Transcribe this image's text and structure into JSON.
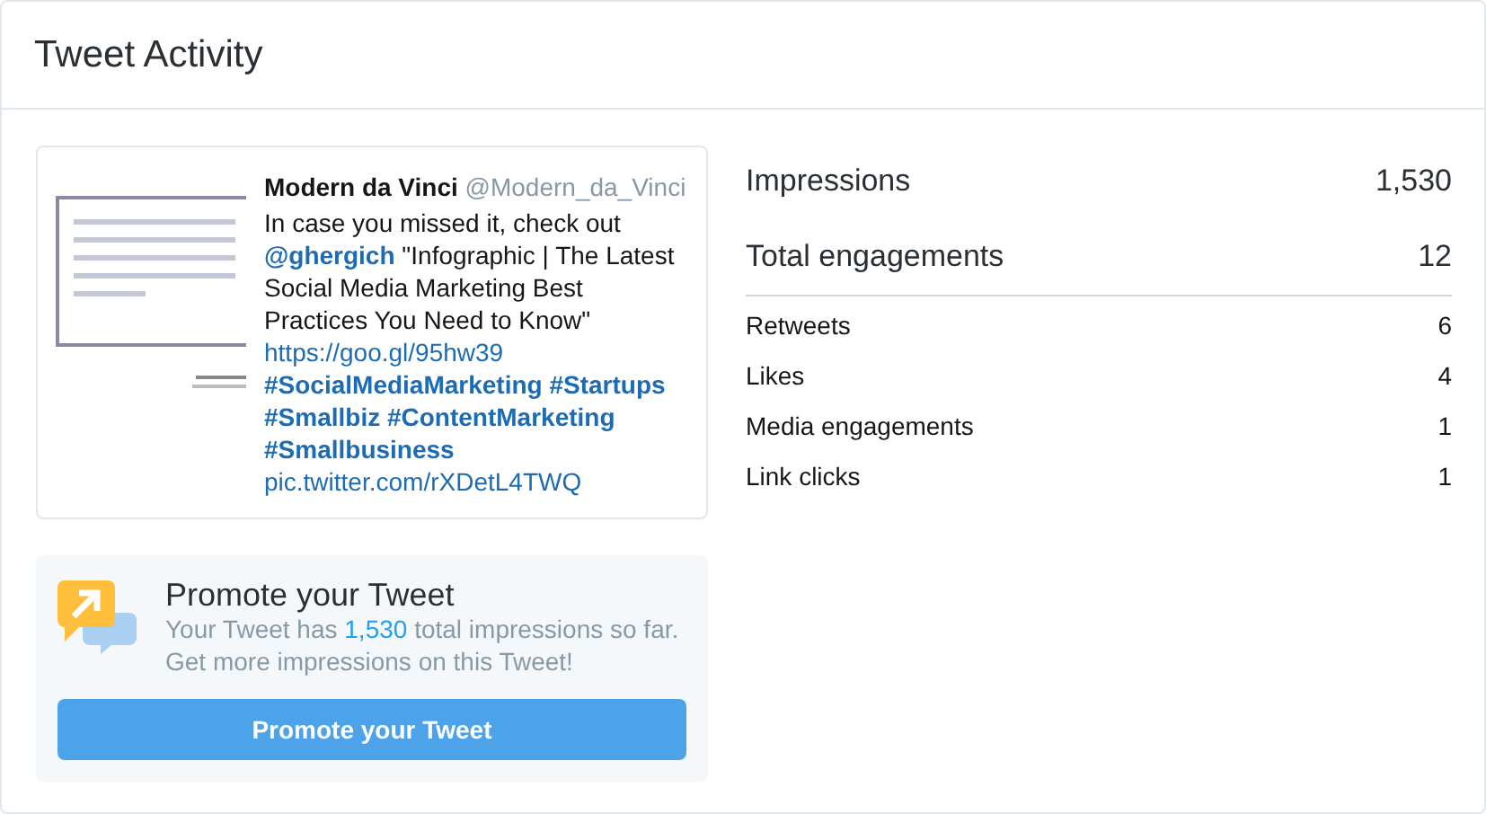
{
  "window": {
    "title": "Tweet Activity"
  },
  "tweet": {
    "author": "Modern da Vinci",
    "handle": "@Modern_da_Vinci",
    "segments": [
      {
        "kind": "text",
        "text": "In case you missed it, check out"
      },
      {
        "kind": "mention",
        "text": "@ghergich"
      },
      {
        "kind": "text",
        "text": "\"Infographic | The Latest Social Media Marketing Best Practices You Need to Know\""
      },
      {
        "kind": "link",
        "text": "https://goo.gl/95hw39"
      },
      {
        "kind": "hashtag",
        "text": "#SocialMediaMarketing"
      },
      {
        "kind": "hashtag",
        "text": "#Startups"
      },
      {
        "kind": "hashtag",
        "text": "#Smallbiz"
      },
      {
        "kind": "hashtag",
        "text": "#ContentMarketing"
      },
      {
        "kind": "hashtag",
        "text": "#Smallbusiness"
      },
      {
        "kind": "link",
        "text": "pic.twitter.com/rXDetL4TWQ"
      }
    ]
  },
  "promote": {
    "title": "Promote your Tweet",
    "message": "Your Tweet has **1,530** total impressions so far.",
    "message_2": "Get more impressions on this Tweet!",
    "button": "Promote your Tweet"
  },
  "metrics": [
    {
      "kind": "major",
      "label": "Impressions",
      "value": "1,530"
    },
    {
      "kind": "major",
      "label": "Total engagements",
      "value": "12"
    },
    {
      "kind": "minor",
      "label": "Retweets",
      "value": "6"
    },
    {
      "kind": "minor",
      "label": "Likes",
      "value": "4"
    },
    {
      "kind": "minor",
      "label": "Media engagements",
      "value": "1"
    },
    {
      "kind": "minor",
      "label": "Link clicks",
      "value": "1"
    }
  ]
}
